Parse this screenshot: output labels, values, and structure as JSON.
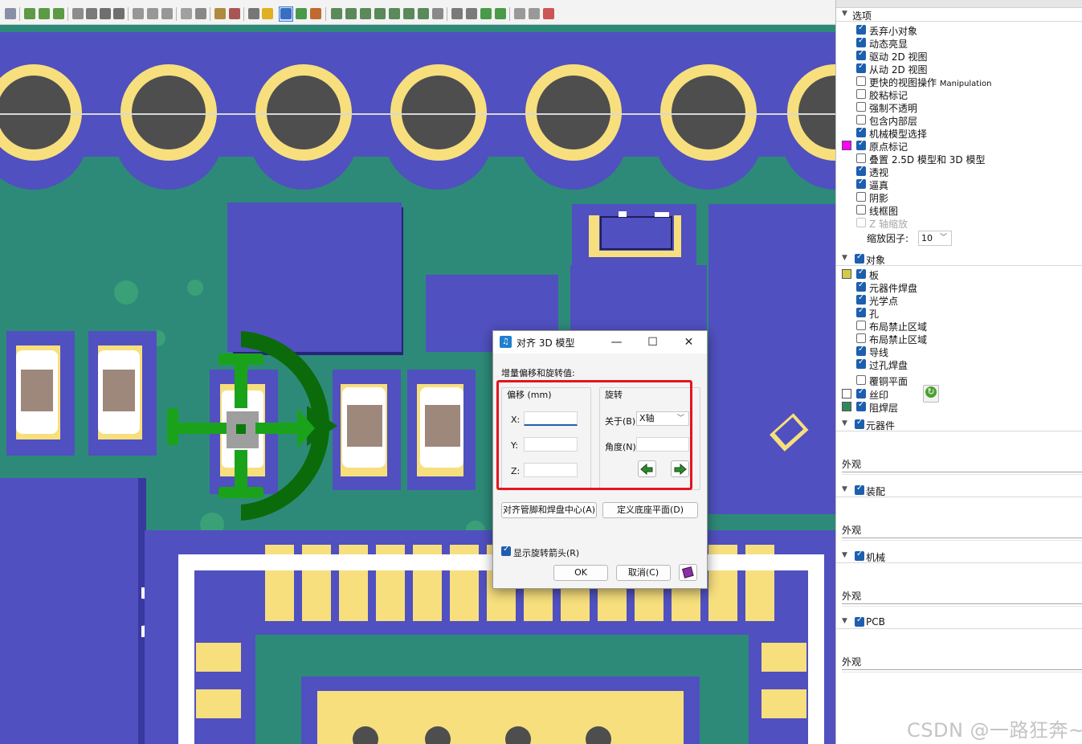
{
  "colors": {
    "board": "#2e8a78",
    "pad_blue": "#5050c0",
    "pad_gold": "#f7df7d",
    "hole": "#4e4e4e",
    "arrow_green": "#1aa31a",
    "highlight_red": "#e5151d",
    "check_blue": "#1d5fae"
  },
  "panel": {
    "sections": {
      "options": "选项",
      "objects": "对象",
      "components": "元器件",
      "assembly": "装配",
      "mechanical": "机械",
      "pcb": "PCB"
    },
    "options": [
      {
        "label": "丢弃小对象",
        "checked": true
      },
      {
        "label": "动态亮显",
        "checked": true
      },
      {
        "label": "驱动 2D 视图",
        "checked": true
      },
      {
        "label": "从动 2D 视图",
        "checked": true
      },
      {
        "label": "更快的视图操作",
        "suffix": "Manipulation",
        "checked": false
      },
      {
        "label": "胶粘标记",
        "checked": false
      },
      {
        "label": "强制不透明",
        "checked": false
      },
      {
        "label": "包含内部层",
        "checked": false
      },
      {
        "label": "机械模型选择",
        "checked": true
      },
      {
        "label": "原点标记",
        "checked": true,
        "swatch": "#ff00ff"
      },
      {
        "label": "叠置 2.5D 模型和 3D 模型",
        "checked": false
      },
      {
        "label": "透视",
        "checked": true
      },
      {
        "label": "逼真",
        "checked": true
      },
      {
        "label": "阴影",
        "checked": false
      },
      {
        "label": "线框图",
        "checked": false
      },
      {
        "label": "Z 轴缩放",
        "checked": false,
        "disabled": true
      }
    ],
    "scale_label": "缩放因子:",
    "scale_value": "10",
    "objects": [
      {
        "label": "板",
        "checked": true,
        "swatch": "#d4c94a"
      },
      {
        "label": "元器件焊盘",
        "checked": true
      },
      {
        "label": "光学点",
        "checked": true
      },
      {
        "label": "孔",
        "checked": true
      },
      {
        "label": "布局禁止区域",
        "checked": false
      },
      {
        "label": "布局禁止区域",
        "checked": false
      },
      {
        "label": "导线",
        "checked": true
      },
      {
        "label": "过孔焊盘",
        "checked": true
      },
      {
        "label": "覆铜平面",
        "checked": false
      },
      {
        "label": "丝印",
        "checked": true,
        "swatch": "#ffffff"
      },
      {
        "label": "阻焊层",
        "checked": true,
        "swatch": "#2e8a5a"
      }
    ],
    "appearance_label": "外观"
  },
  "dialog": {
    "title": "对齐 3D 模型",
    "minimize": "—",
    "maximize": "☐",
    "close": "✕",
    "heading": "增量偏移和旋转值:",
    "offset_group": "偏移 (mm)",
    "rotation_group": "旋转",
    "x_label": "X:",
    "y_label": "Y:",
    "z_label": "Z:",
    "x_value": "",
    "y_value": "",
    "z_value": "",
    "about_label": "关于(B):",
    "about_value": "X轴",
    "angle_label": "角度(N):",
    "angle_value": "",
    "align_pins_button": "对齐管脚和焊盘中心(A)",
    "define_base_button": "定义底座平面(D)",
    "show_arrows_label": "显示旋转箭头(R)",
    "show_arrows_checked": true,
    "ok_button": "OK",
    "cancel_button": "取消(C)"
  },
  "watermark": "CSDN @一路狂奔~"
}
